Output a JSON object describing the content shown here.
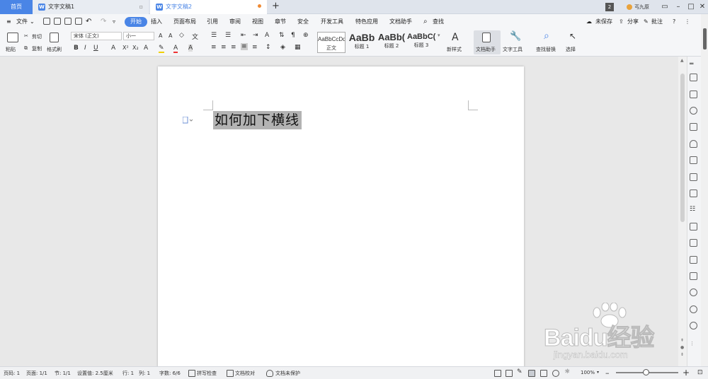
{
  "tabs": {
    "home": "首页",
    "doc1": "文字文稿1",
    "doc2": "文字文稿2",
    "add": "+",
    "badge": "2",
    "user": "丐九原"
  },
  "menubar": {
    "file": "文件",
    "items": [
      "开始",
      "插入",
      "页面布局",
      "引用",
      "审阅",
      "视图",
      "章节",
      "安全",
      "开发工具",
      "特色应用",
      "文档助手"
    ],
    "search": "查找",
    "unsaved": "未保存",
    "share": "分享",
    "comment": "批注"
  },
  "ribbon": {
    "paste": "粘贴",
    "cut": "剪切",
    "copy": "复制",
    "format_painter": "格式刷",
    "font_name": "宋体 (正文)",
    "font_size": "小一",
    "styles": [
      {
        "sample": "AaBbCcDd",
        "label": "正文"
      },
      {
        "sample": "AaBb",
        "label": "标题 1"
      },
      {
        "sample": "AaBb(",
        "label": "标题 2"
      },
      {
        "sample": "AaBbC(",
        "label": "标题 3"
      }
    ],
    "new_style": "新样式",
    "doc_helper": "文档助手",
    "text_tools": "文字工具",
    "find_replace": "查找替换",
    "select": "选择"
  },
  "document": {
    "text": "如何加下横线"
  },
  "status": {
    "page_no": "页码: 1",
    "pages": "页面: 1/1",
    "section": "节: 1/1",
    "setting": "设置值: 2.5厘米",
    "row": "行: 1",
    "col": "列: 1",
    "words": "字数: 6/6",
    "spellcheck": "拼写检查",
    "proofread": "文档校对",
    "protect": "文档未保护",
    "zoom": "100%"
  },
  "watermark": {
    "brand": "Baidu经验",
    "url": "jingyan.baidu.com"
  },
  "colors": {
    "accent": "#4a85e6",
    "selection": "#b3b3b3"
  }
}
